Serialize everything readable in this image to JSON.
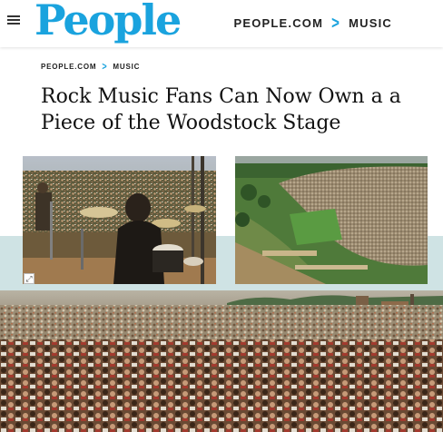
{
  "header": {
    "logo_text": "People",
    "site_label": "PEOPLE.COM",
    "section_label": "MUSIC",
    "brand_color": "#1aa3de"
  },
  "breadcrumb": {
    "site": "PEOPLE.COM",
    "section": "MUSIC"
  },
  "article": {
    "headline": "Rock Music Fans Can Now Own a a Piece of the Woodstock Stage"
  },
  "icons": {
    "menu": "hamburger-menu-icon",
    "separator": "chevron-right-icon",
    "expand": "expand-icon"
  }
}
